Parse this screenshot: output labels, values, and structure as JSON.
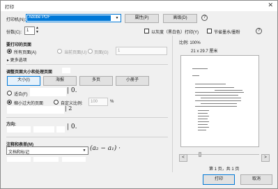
{
  "window": {
    "title": "打印",
    "close_glyph": "✕"
  },
  "printer": {
    "label": "打印机(N):",
    "selected": "Adobe PDF",
    "properties_button": "属性(P)",
    "advanced_button": "高级(D)",
    "help_glyph": "?"
  },
  "copies": {
    "label": "份数(C):",
    "value": "1",
    "grayscale_label": "以灰度（黑白色）打印(Y)",
    "save_ink_label": "节省墨水/墨粉"
  },
  "pages": {
    "heading": "要打印的页面",
    "all_label": "所有页面(A)",
    "current_label": "当前页面(U)",
    "pages_label": "页面(G)",
    "pages_value": "1",
    "more_options": "▸ 更多选项"
  },
  "sizing": {
    "heading": "调整页面大小和处理页面",
    "size_button": "大小(I)",
    "poster_button": "海报",
    "multiple_button": "多页",
    "booklet_button": "小册子",
    "fit_label": "适合(F)",
    "shrink_label": "缩小过大的页面",
    "custom_label": "自定义比例:",
    "custom_value": "100",
    "percent": "%",
    "math_snippet": "0.",
    "math_snippet2": "2"
  },
  "orientation": {
    "heading": "方向:",
    "math_snippet": "0."
  },
  "comments": {
    "heading": "注释和表单(M)",
    "selected": "文档和标记",
    "formula": "(a₂ − a₁) ·"
  },
  "preview": {
    "scale_label": "比例: 100%",
    "paper_size": "21 x 29.7 厘米",
    "page_info": "第 1 页，共 1 页",
    "prev_glyph": "<",
    "next_glyph": ">"
  },
  "footer": {
    "print_button": "打印",
    "cancel_button": "取消"
  }
}
